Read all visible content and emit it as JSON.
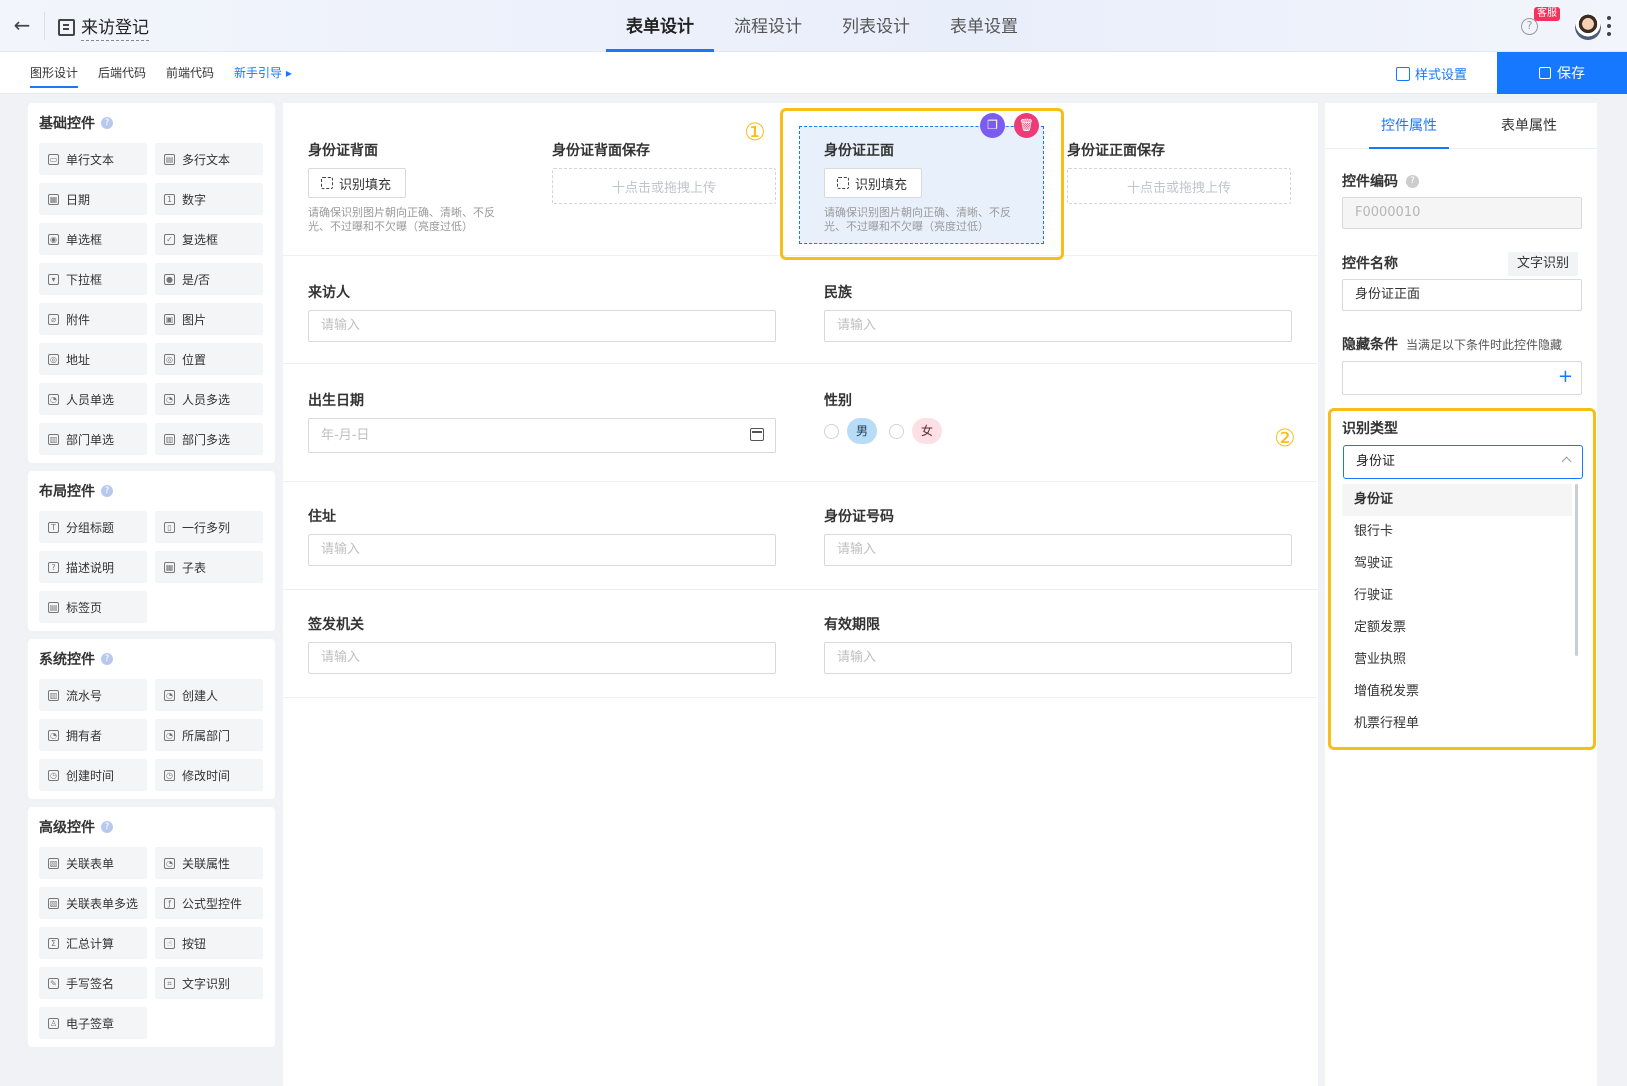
{
  "header": {
    "app_title": "来访登记",
    "tabs": [
      "表单设计",
      "流程设计",
      "列表设计",
      "表单设置"
    ],
    "active_tab": 0,
    "badge": "客服"
  },
  "subbar": {
    "tabs": [
      "图形设计",
      "后端代码",
      "前端代码"
    ],
    "guide": "新手引导",
    "style_btn": "样式设置",
    "save_btn": "保存"
  },
  "left": {
    "groups": [
      {
        "title": "基础控件",
        "items": [
          {
            "label": "单行文本",
            "icon": "single-line-text-icon",
            "g": "▭"
          },
          {
            "label": "多行文本",
            "icon": "multi-line-text-icon",
            "g": "▤"
          },
          {
            "label": "日期",
            "icon": "date-icon",
            "g": "▦"
          },
          {
            "label": "数字",
            "icon": "number-icon",
            "g": "1"
          },
          {
            "label": "单选框",
            "icon": "radio-icon",
            "g": "◉"
          },
          {
            "label": "复选框",
            "icon": "checkbox-icon",
            "g": "✓"
          },
          {
            "label": "下拉框",
            "icon": "dropdown-icon",
            "g": "▾"
          },
          {
            "label": "是/否",
            "icon": "toggle-icon",
            "g": "●"
          },
          {
            "label": "附件",
            "icon": "attachment-icon",
            "g": "⌀"
          },
          {
            "label": "图片",
            "icon": "image-icon",
            "g": "▣"
          },
          {
            "label": "地址",
            "icon": "address-pin-icon",
            "g": "◎"
          },
          {
            "label": "位置",
            "icon": "location-icon",
            "g": "◎"
          },
          {
            "label": "人员单选",
            "icon": "user-icon",
            "g": "◔"
          },
          {
            "label": "人员多选",
            "icon": "users-icon",
            "g": "◔"
          },
          {
            "label": "部门单选",
            "icon": "department-icon",
            "g": "▥"
          },
          {
            "label": "部门多选",
            "icon": "departments-icon",
            "g": "▥"
          }
        ]
      },
      {
        "title": "布局控件",
        "items": [
          {
            "label": "分组标题",
            "icon": "group-title-icon",
            "g": "T"
          },
          {
            "label": "一行多列",
            "icon": "columns-icon",
            "g": "▯"
          },
          {
            "label": "描述说明",
            "icon": "description-icon",
            "g": "?"
          },
          {
            "label": "子表",
            "icon": "subtable-icon",
            "g": "▦"
          },
          {
            "label": "标签页",
            "icon": "tabs-icon",
            "g": "▤"
          }
        ]
      },
      {
        "title": "系统控件",
        "items": [
          {
            "label": "流水号",
            "icon": "serial-number-icon",
            "g": "▥"
          },
          {
            "label": "创建人",
            "icon": "creator-icon",
            "g": "◔"
          },
          {
            "label": "拥有者",
            "icon": "owner-icon",
            "g": "◔"
          },
          {
            "label": "所属部门",
            "icon": "org-icon",
            "g": "◔"
          },
          {
            "label": "创建时间",
            "icon": "clock-icon",
            "g": "◷"
          },
          {
            "label": "修改时间",
            "icon": "modify-time-icon",
            "g": "◷"
          }
        ]
      },
      {
        "title": "高级控件",
        "items": [
          {
            "label": "关联表单",
            "icon": "link-form-icon",
            "g": "▧"
          },
          {
            "label": "关联属性",
            "icon": "link-attr-icon",
            "g": "◔"
          },
          {
            "label": "关联表单多选",
            "icon": "link-form-multi-icon",
            "g": "▧"
          },
          {
            "label": "公式型控件",
            "icon": "formula-icon",
            "g": "ƒ"
          },
          {
            "label": "汇总计算",
            "icon": "sum-icon",
            "g": "Σ"
          },
          {
            "label": "按钮",
            "icon": "button-icon",
            "g": "☝"
          },
          {
            "label": "手写签名",
            "icon": "signature-icon",
            "g": "✎"
          },
          {
            "label": "文字识别",
            "icon": "ocr-icon",
            "g": "⌗"
          },
          {
            "label": "电子签章",
            "icon": "seal-icon",
            "g": "♙"
          }
        ]
      }
    ]
  },
  "canvas": {
    "id_back": {
      "label": "身份证背面",
      "btn": "识别填充",
      "hint": "请确保识别图片朝向正确、清晰、不反光、不过曝和不欠曝（亮度过低）"
    },
    "id_back_save": {
      "label": "身份证背面保存",
      "upload": "十点击或拖拽上传"
    },
    "id_front": {
      "label": "身份证正面",
      "btn": "识别填充",
      "hint": "请确保识别图片朝向正确、清晰、不反光、不过曝和不欠曝（亮度过低）"
    },
    "id_front_save": {
      "label": "身份证正面保存",
      "upload": "十点击或拖拽上传"
    },
    "visitor": {
      "label": "来访人",
      "placeholder": "请输入"
    },
    "ethnicity": {
      "label": "民族",
      "placeholder": "请输入"
    },
    "birth": {
      "label": "出生日期",
      "placeholder": "年-月-日"
    },
    "gender": {
      "label": "性别",
      "male": "男",
      "female": "女"
    },
    "address": {
      "label": "住址",
      "placeholder": "请输入"
    },
    "idno": {
      "label": "身份证号码",
      "placeholder": "请输入"
    },
    "issuer": {
      "label": "签发机关",
      "placeholder": "请输入"
    },
    "validity": {
      "label": "有效期限",
      "placeholder": "请输入"
    },
    "marker1": "①",
    "marker2": "②"
  },
  "right": {
    "tabs": [
      "控件属性",
      "表单属性"
    ],
    "code_label": "控件编码",
    "code_value": "F0000010",
    "name_label": "控件名称",
    "ocr_tag": "文字识别",
    "name_value": "身份证正面",
    "hide_label": "隐藏条件",
    "hide_note": "当满足以下条件时此控件隐藏",
    "type_label": "识别类型",
    "type_value": "身份证",
    "type_options": [
      "身份证",
      "银行卡",
      "驾驶证",
      "行驶证",
      "定额发票",
      "营业执照",
      "增值税发票",
      "机票行程单"
    ]
  },
  "colors": {
    "accent": "#1677ff",
    "highlight": "#f7be19"
  }
}
